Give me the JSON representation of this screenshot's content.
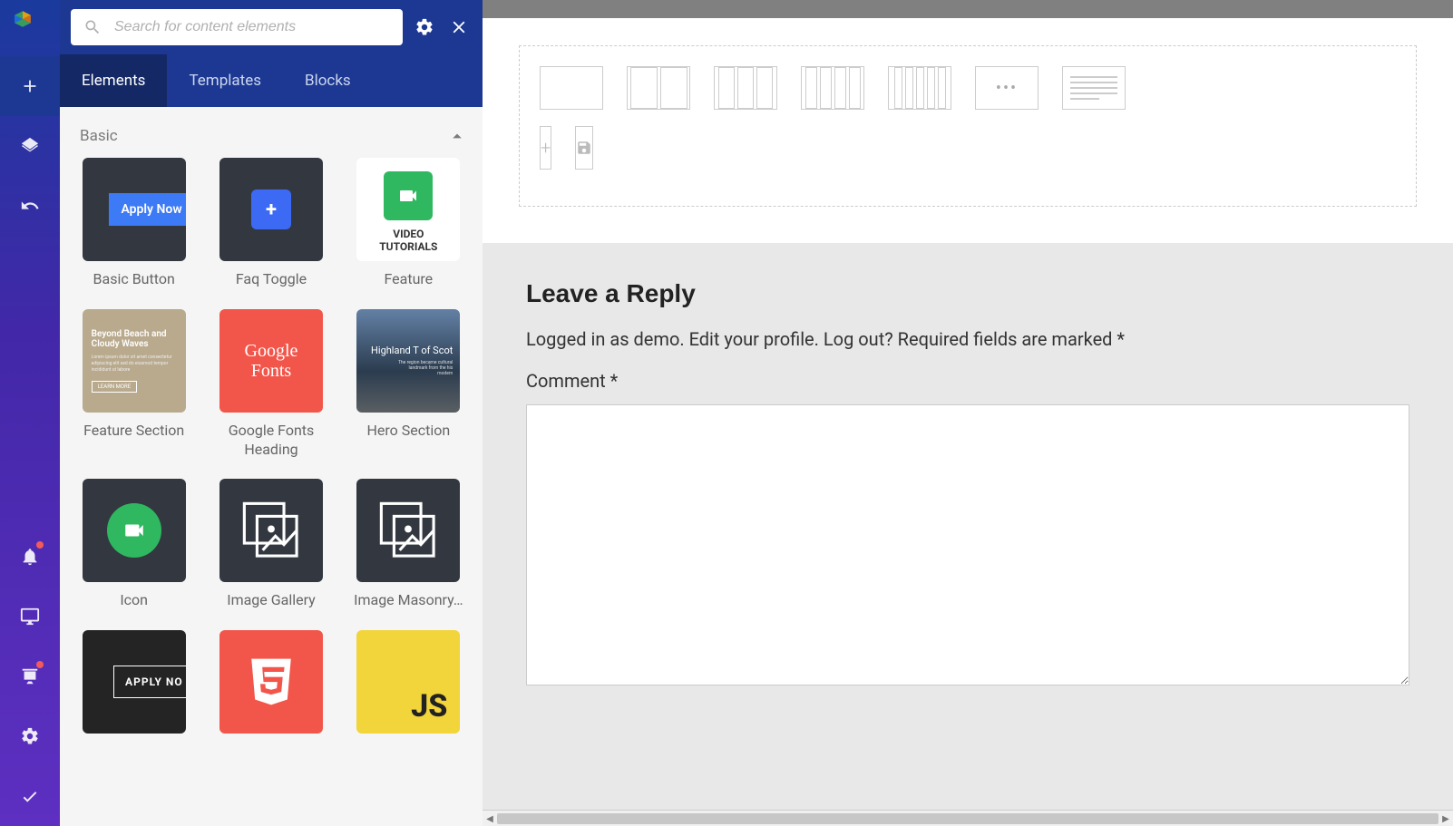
{
  "search": {
    "placeholder": "Search for content elements"
  },
  "tabs": [
    {
      "label": "Elements",
      "active": true
    },
    {
      "label": "Templates",
      "active": false
    },
    {
      "label": "Blocks",
      "active": false
    }
  ],
  "section_title": "Basic",
  "elements": [
    {
      "label": "Basic Button",
      "kind": "basic-button",
      "inner": "Apply Now"
    },
    {
      "label": "Faq Toggle",
      "kind": "faq",
      "inner": "+"
    },
    {
      "label": "Feature",
      "kind": "feature",
      "inner": "VIDEO TUTORIALS"
    },
    {
      "label": "Feature Section",
      "kind": "feature-section",
      "heading": "Beyond Beach and Cloudy Waves"
    },
    {
      "label": "Google Fonts Heading",
      "kind": "gfonts",
      "inner": "Google Fonts"
    },
    {
      "label": "Hero Section",
      "kind": "hero",
      "heading": "Highland T of Scot"
    },
    {
      "label": "Icon",
      "kind": "icon"
    },
    {
      "label": "Image Gallery",
      "kind": "gallery"
    },
    {
      "label": "Image Masonry…",
      "kind": "masonry"
    },
    {
      "label": "",
      "kind": "outline-btn",
      "inner": "APPLY NO"
    },
    {
      "label": "",
      "kind": "html5"
    },
    {
      "label": "",
      "kind": "js",
      "inner": "JS"
    }
  ],
  "reply": {
    "heading": "Leave a Reply",
    "meta": "Logged in as demo. Edit your profile. Log out? Required fields are marked *",
    "comment_label": "Comment *"
  }
}
